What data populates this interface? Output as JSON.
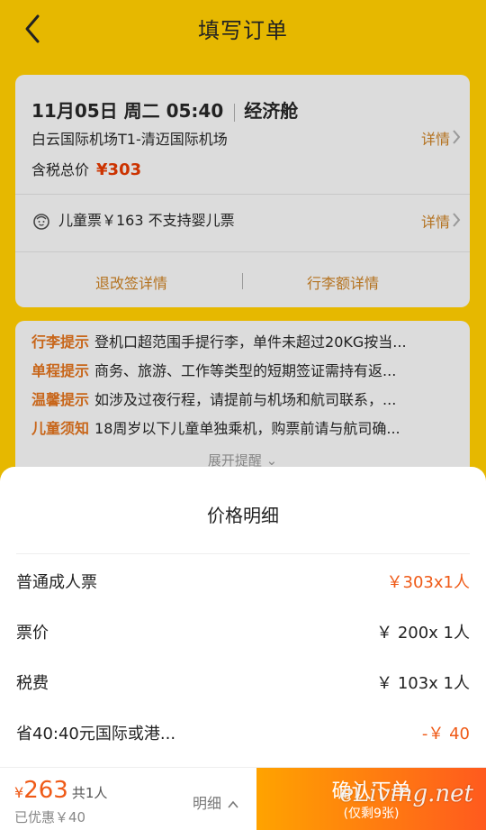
{
  "header": {
    "title": "填写订单"
  },
  "flight": {
    "date_time": "11月05日 周二 05:40",
    "cabin": "经济舱",
    "route": "白云国际机场T1-清迈国际机场",
    "detail_link": "详情",
    "price_label": "含税总价",
    "price_value": "¥303",
    "child_info": "儿童票￥163   不支持婴儿票",
    "child_detail_link": "详情",
    "refund_link": "退改签详情",
    "baggage_link": "行李额详情"
  },
  "tips": [
    {
      "label": "行李提示",
      "text": "登机口超范围手提行李，单件未超过20KG按当..."
    },
    {
      "label": "单程提示",
      "text": "商务、旅游、工作等类型的短期签证需持有返..."
    },
    {
      "label": "温馨提示",
      "text": "如涉及过夜行程，请提前与机场和航司联系，..."
    },
    {
      "label": "儿童须知",
      "text": "18周岁以下儿童单独乘机，购票前请与航司确..."
    }
  ],
  "expand_label": "展开提醒 ⌄",
  "price_sheet": {
    "title": "价格明细",
    "rows": [
      {
        "label": "普通成人票",
        "value": "￥303x1人"
      },
      {
        "label": "票价",
        "value": "￥ 200x 1人"
      },
      {
        "label": "税费",
        "value": "￥ 103x 1人"
      },
      {
        "label": "省40:40元国际或港...",
        "value": "-￥ 40"
      }
    ]
  },
  "footer": {
    "currency": "¥",
    "total": "263",
    "count": "共1人",
    "saved": "已优惠￥40",
    "detail_toggle": "明细",
    "confirm_label": "确认下单",
    "remaining": "(仅剩9张)",
    "watermark": "eLiving.net"
  },
  "colors": {
    "theme_yellow": "#e6b800",
    "accent_orange": "#ef5a17",
    "link_brown": "#b4721f"
  },
  "icons": [
    "back-arrow-icon",
    "chevron-right-icon",
    "baby-face-icon",
    "chevron-up-icon"
  ]
}
